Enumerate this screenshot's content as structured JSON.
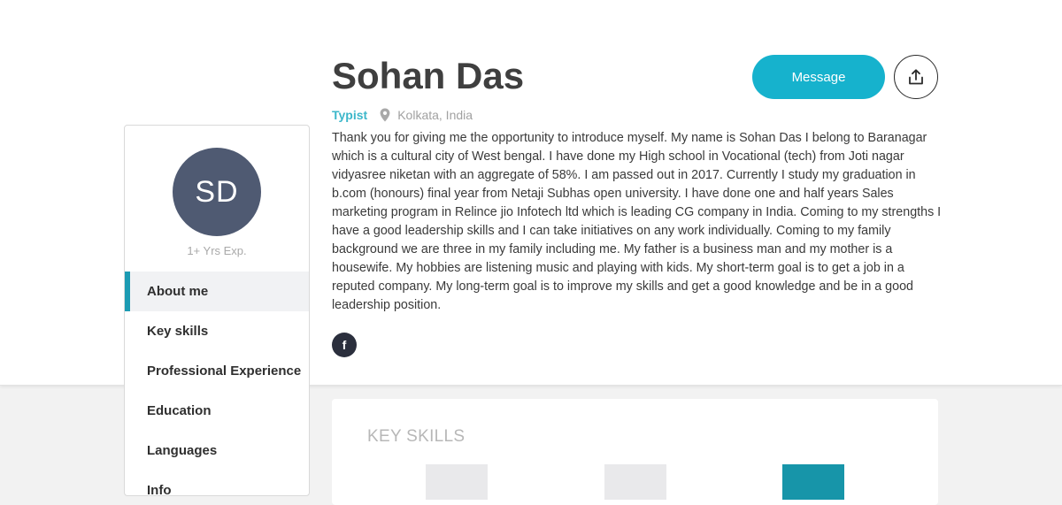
{
  "profile": {
    "initials": "SD",
    "name": "Sohan Das",
    "role": "Typist",
    "location": "Kolkata, India",
    "experience": "1+ Yrs Exp.",
    "avatar_color": "#4f5a72",
    "bio": "Thank you for giving me the opportunity to introduce myself. My name is Sohan Das I belong to Baranagar which is a cultural city of West bengal. I have done my High school in Vocational (tech) from Joti nagar vidyasree niketan with an aggregate of 58%. I am passed out in 2017. Currently I study my graduation in b.com (honours) final year from Netaji Subhas open university. I have done one and half years Sales marketing program in Relince jio Infotech ltd which is leading CG company in India. Coming to my strengths I have a good leadership skills and I can take initiatives on any work individually. Coming to my family background we are three in my family including me. My father is a business man and my mother is a housewife. My hobbies are listening music and playing with kids. My short-term goal is to get a job in a reputed company. My long-term goal is to improve my skills and get a good knowledge and be in a good leadership position."
  },
  "actions": {
    "message_label": "Message",
    "share_icon": "share-icon",
    "social_icon": "facebook-icon"
  },
  "nav": {
    "items": [
      {
        "label": "About me",
        "active": true
      },
      {
        "label": "Key skills",
        "active": false
      },
      {
        "label": "Professional Experience",
        "active": false
      },
      {
        "label": "Education",
        "active": false
      },
      {
        "label": "Languages",
        "active": false
      },
      {
        "label": "Info",
        "active": false
      }
    ]
  },
  "skills": {
    "title": "KEY SKILLS"
  },
  "colors": {
    "accent": "#16b2cd",
    "role_text": "#3cb7ca",
    "active_indicator": "#1c9bb3",
    "skill_filled": "#1795a9",
    "skill_empty": "#e9e9eb"
  }
}
